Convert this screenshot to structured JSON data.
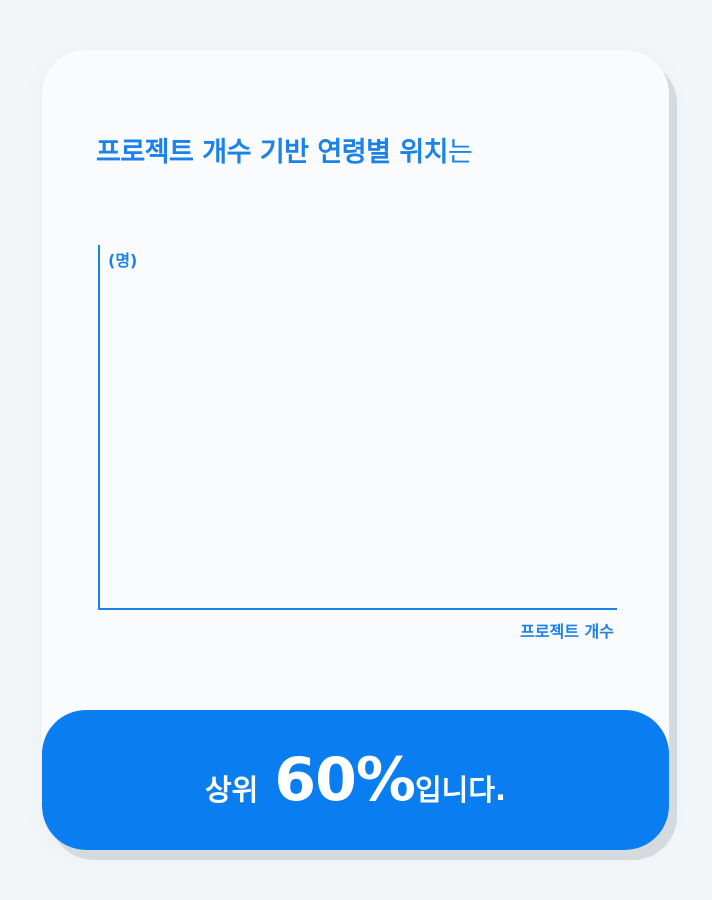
{
  "card": {
    "title_main": "프로젝트 개수 기반 연령별 위치",
    "title_suffix": "는"
  },
  "chart_data": {
    "type": "scatter",
    "ylabel": "(명)",
    "xlabel": "프로젝트 개수",
    "series": [],
    "color": "#1a82ea"
  },
  "result": {
    "prefix": "상위",
    "value": "60%",
    "suffix": "입니다."
  },
  "colors": {
    "accent": "#1a82ea",
    "banner": "#0a7df0",
    "card": "#fafbfc",
    "background": "#f2f6f8"
  }
}
